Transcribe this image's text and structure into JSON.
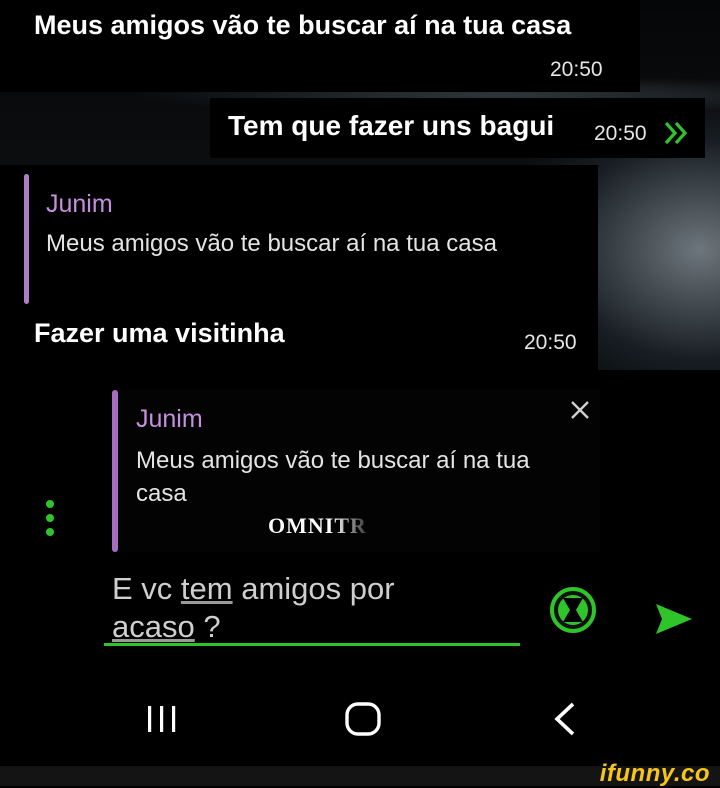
{
  "conversation": {
    "messages": [
      {
        "text": "Meus amigos vão te buscar aí na tua casa",
        "time": "20:50"
      },
      {
        "text": "Tem que fazer uns bagui",
        "time": "20:50",
        "status_icon": "double-chevron-icon"
      },
      {
        "quote": {
          "name": "Junim",
          "text": "Meus amigos vão te buscar aí na tua casa"
        },
        "text": "Fazer uma visitinha",
        "time": "20:50"
      }
    ]
  },
  "reply_preview": {
    "name": "Junim",
    "text": "Meus amigos vão te buscar aí na tua casa",
    "close_icon": "close-icon",
    "watermark": "OMNITR"
  },
  "compose": {
    "text_part1": "E vc ",
    "text_underlined1": "tem",
    "text_part2": " amigos por",
    "text_underlined2": "acaso",
    "text_part3": " ?",
    "sticker_icon": "omnitrix-icon",
    "send_icon": "send-icon",
    "more_icon": "more-vertical-icon"
  },
  "navbar": {
    "recents_icon": "recents-icon",
    "home_icon": "home-icon",
    "back_icon": "back-icon"
  },
  "footer": {
    "logo": "ifunny.co"
  },
  "colors": {
    "accent_green": "#2fc52a",
    "quote_purple": "#c68fe0",
    "logo_yellow": "#f7c518"
  }
}
